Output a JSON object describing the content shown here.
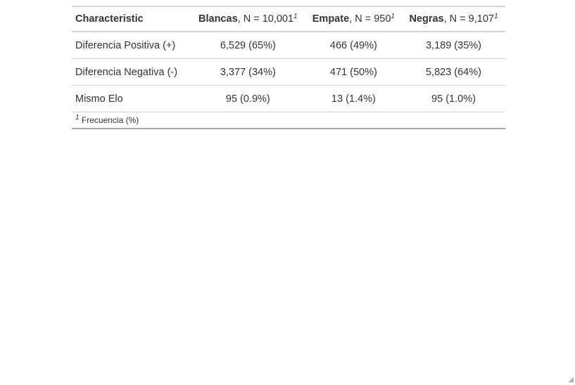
{
  "table": {
    "header": {
      "label": "Characteristic",
      "columns": [
        {
          "name": "Blancas",
          "suffix": ", N = 10,001",
          "footnote": "1"
        },
        {
          "name": "Empate",
          "suffix": ", N = 950",
          "footnote": "1"
        },
        {
          "name": "Negras",
          "suffix": ", N = 9,107",
          "footnote": "1"
        }
      ]
    },
    "rows": [
      {
        "label": "Diferencia Positiva (+)",
        "cells": [
          "6,529 (65%)",
          "466 (49%)",
          "3,189 (35%)"
        ]
      },
      {
        "label": "Diferencia Negativa (-)",
        "cells": [
          "3,377 (34%)",
          "471 (50%)",
          "5,823 (64%)"
        ]
      },
      {
        "label": "Mismo Elo",
        "cells": [
          "95 (0.9%)",
          "13 (1.4%)",
          "95 (1.0%)"
        ]
      }
    ],
    "footnote": {
      "marker": "1",
      "text": "Frecuencia (%)"
    }
  },
  "icons": {
    "resize_grip": "resize-grip-icon"
  }
}
